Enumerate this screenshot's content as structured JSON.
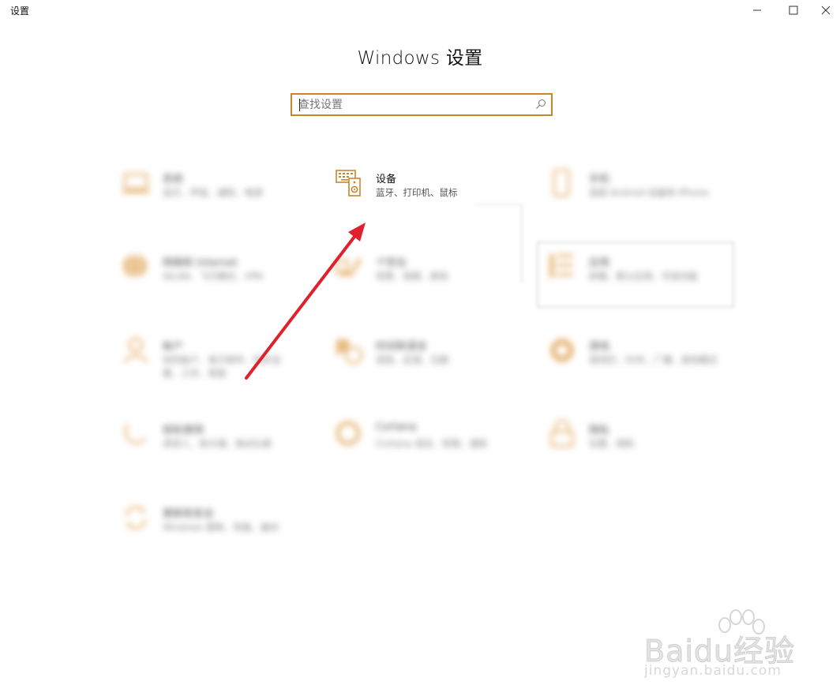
{
  "window": {
    "app_title": "设置",
    "minimize_label": "—",
    "maximize_label": "☐",
    "close_label": "✕"
  },
  "heading": "Windows 设置",
  "search": {
    "placeholder": "查找设置"
  },
  "tiles": [
    {
      "icon": "laptop-icon",
      "title": "系统",
      "desc": "显示、声音、通知、电源",
      "blurred": true
    },
    {
      "icon": "devices-icon",
      "title": "设备",
      "desc": "蓝牙、打印机、鼠标",
      "blurred": false
    },
    {
      "icon": "phone-icon",
      "title": "手机",
      "desc": "连接 Android 设备和 iPhone",
      "blurred": true
    },
    {
      "icon": "globe-icon",
      "title": "网络和 Internet",
      "desc": "WLAN、飞行模式、VPN",
      "blurred": true
    },
    {
      "icon": "personalization-icon",
      "title": "个性化",
      "desc": "背景、锁屏、颜色",
      "blurred": true
    },
    {
      "icon": "apps-icon",
      "title": "应用",
      "desc": "卸载、默认应用、可选功能",
      "blurred": true
    },
    {
      "icon": "person-icon",
      "title": "帐户",
      "desc": "你的帐户、电子邮件、同步设置、工作、家庭",
      "blurred": true
    },
    {
      "icon": "time-language-icon",
      "title": "时间和语言",
      "desc": "语音、区域、日期",
      "blurred": true
    },
    {
      "icon": "gaming-icon",
      "title": "游戏",
      "desc": "游戏栏、DVR、广播、游戏模式",
      "blurred": true
    },
    {
      "icon": "ease-of-access-icon",
      "title": "轻松使用",
      "desc": "讲述人、放大镜、高对比度",
      "blurred": true
    },
    {
      "icon": "cortana-icon",
      "title": "Cortana",
      "desc": "Cortana 语言、权限、通知",
      "blurred": true
    },
    {
      "icon": "lock-icon",
      "title": "隐私",
      "desc": "位置、相机",
      "blurred": true
    },
    {
      "icon": "update-icon",
      "title": "更新和安全",
      "desc": "Windows 更新、恢复、备份",
      "blurred": true
    }
  ],
  "watermark": {
    "text": "Baidu经验",
    "sub": "jingyan.baidu.com"
  },
  "colors": {
    "accent": "#c8862b",
    "arrow": "#e0202a"
  }
}
